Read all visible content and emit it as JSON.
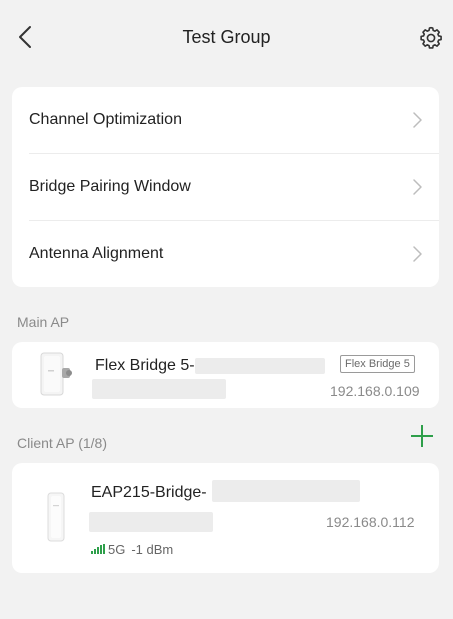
{
  "header": {
    "title": "Test Group"
  },
  "menu": {
    "items": [
      {
        "label": "Channel Optimization"
      },
      {
        "label": "Bridge Pairing Window"
      },
      {
        "label": "Antenna Alignment"
      }
    ]
  },
  "main_ap": {
    "section_label": "Main AP",
    "name": "Flex Bridge 5-",
    "model_badge": "Flex Bridge 5",
    "ip": "192.168.0.109"
  },
  "client_ap": {
    "section_label": "Client AP (1/8)",
    "devices": [
      {
        "name": "EAP215-Bridge-",
        "ip": "192.168.0.112",
        "band": "5G",
        "signal": "-1 dBm"
      }
    ]
  },
  "colors": {
    "accent_green": "#2e9f4a",
    "background": "#f2f2f2"
  },
  "icons": {
    "back": "chevron-left-icon",
    "settings": "gear-icon",
    "chevron": "chevron-right-icon",
    "add": "plus-icon",
    "signal": "signal-bars-icon"
  }
}
